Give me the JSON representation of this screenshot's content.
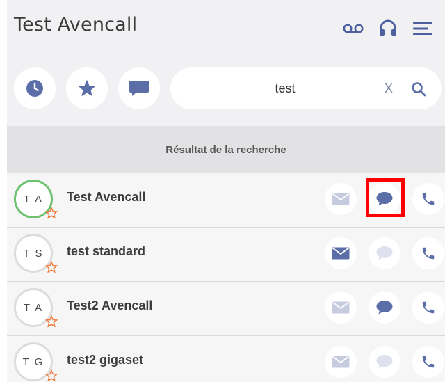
{
  "header": {
    "title": "Test Avencall",
    "icons": [
      "voicemail-icon",
      "headset-icon",
      "menu-icon"
    ]
  },
  "filters": {
    "icons": [
      "clock-icon",
      "star-icon",
      "chat-icon"
    ]
  },
  "search": {
    "value": "test",
    "clear_label": "X"
  },
  "results": {
    "title": "Résultat de la recherche"
  },
  "colors": {
    "accent": "#5b6ea8",
    "muted": "#c7cbe0",
    "online": "#6cc26f",
    "favorite": "#f07a3c",
    "highlight": "#ff0000"
  },
  "contacts": [
    {
      "initials": "T A",
      "name": "Test Avencall",
      "online": true,
      "favorite": true,
      "email_enabled": false,
      "chat_enabled": true,
      "call_enabled": true
    },
    {
      "initials": "T S",
      "name": "test standard",
      "online": false,
      "favorite": true,
      "email_enabled": true,
      "chat_enabled": false,
      "call_enabled": true
    },
    {
      "initials": "T A",
      "name": "Test2 Avencall",
      "online": false,
      "favorite": true,
      "email_enabled": false,
      "chat_enabled": true,
      "call_enabled": true
    },
    {
      "initials": "T G",
      "name": "test2 gigaset",
      "online": false,
      "favorite": true,
      "email_enabled": false,
      "chat_enabled": false,
      "call_enabled": true
    }
  ]
}
